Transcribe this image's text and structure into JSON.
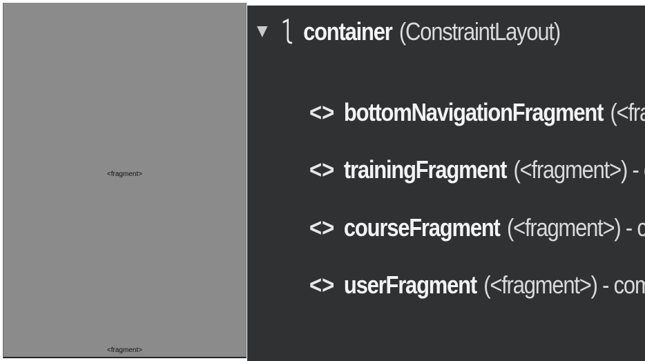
{
  "preview": {
    "fragment_main_label": "<fragment>",
    "fragment_bottom_label": "<fragment>"
  },
  "tree": {
    "root": {
      "name": "container",
      "meta": "(ConstraintLayout)",
      "icon": "constraint-layout-icon",
      "expanded": true
    },
    "children": [
      {
        "icon_glyph": "<>",
        "icon": "fragment-tag-icon",
        "name": "bottomNavigationFragment",
        "meta": "(<fragme"
      },
      {
        "icon_glyph": "<>",
        "icon": "fragment-tag-icon",
        "name": "trainingFragment",
        "meta": "(<fragment>) - com."
      },
      {
        "icon_glyph": "<>",
        "icon": "fragment-tag-icon",
        "name": "courseFragment",
        "meta": "(<fragment>) - com.e"
      },
      {
        "icon_glyph": "<>",
        "icon": "fragment-tag-icon",
        "name": "userFragment",
        "meta": "(<fragment>) - com.exa"
      }
    ]
  },
  "colors": {
    "preview_bg": "#8b8b8b",
    "tree_bg": "#2f3133",
    "text_primary": "#f2f3f4",
    "text_secondary": "#d8dadc"
  }
}
